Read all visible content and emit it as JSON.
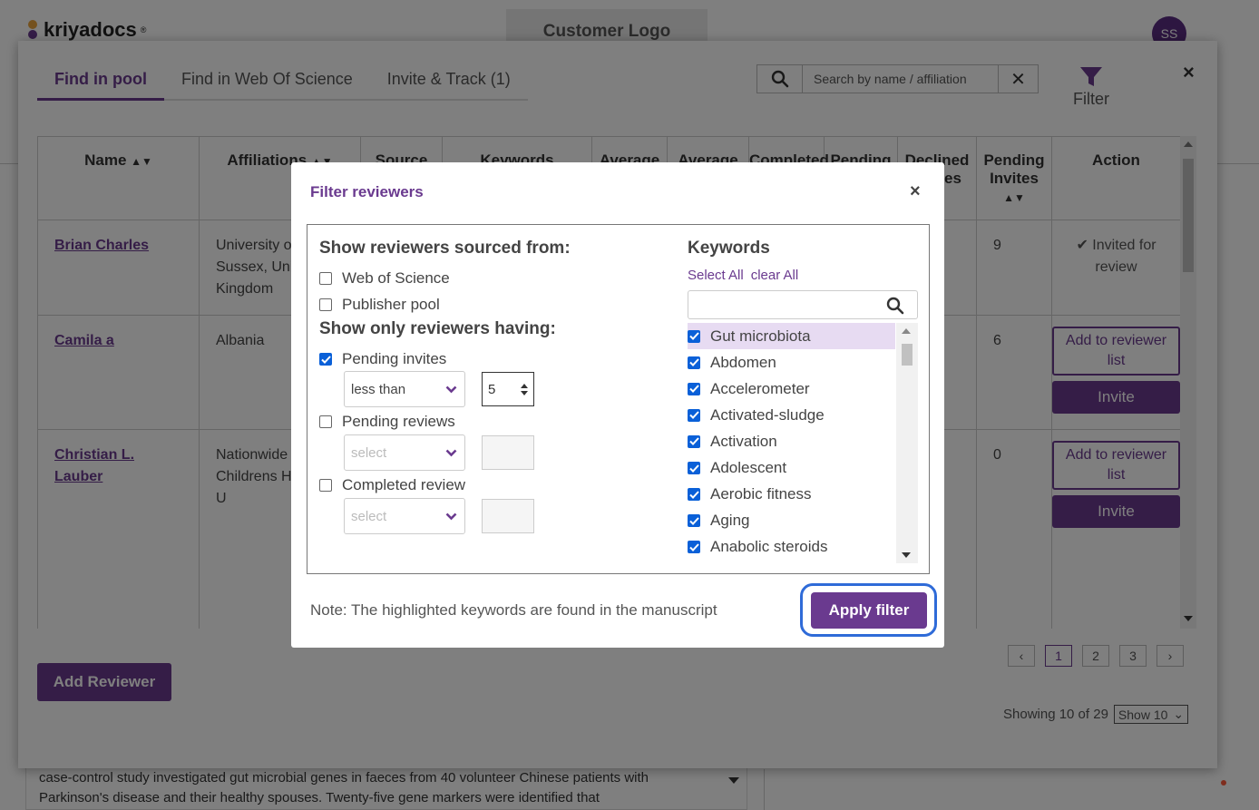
{
  "app": {
    "logo_text": "kriyadocs",
    "logo_mark": "®",
    "customer_logo": "Customer Logo",
    "avatar_initials": "SS",
    "abstract_text": "case-control study investigated gut microbial genes in faeces from 40 volunteer Chinese patients with Parkinson's disease and their healthy spouses. Twenty-five gene markers were identified that"
  },
  "reviewer_modal": {
    "tabs": [
      {
        "label": "Find in pool",
        "active": true
      },
      {
        "label": "Find in Web Of Science",
        "active": false
      },
      {
        "label": "Invite & Track (1)",
        "active": false
      }
    ],
    "search_placeholder": "Search by name / affiliation",
    "search_clear": "✕",
    "filter_label": "Filter",
    "close": "×",
    "table": {
      "headers": [
        "Name",
        "Affiliations",
        "Source",
        "Keywords",
        "Average",
        "Average",
        "Completed",
        "Pending",
        "Declined Invites",
        "Pending Invites",
        "Action"
      ],
      "rows": [
        {
          "name": "Brian Charles",
          "affiliation": "University of Sussex, United Kingdom",
          "pending_invites": "9",
          "action": "Invited for review"
        },
        {
          "name": "Camila a",
          "affiliation": "Albania",
          "pending_invites": "6",
          "action_add": "Add to reviewer list",
          "action_invite": "Invite"
        },
        {
          "name": "Christian L. Lauber",
          "affiliation": "Nationwide Childrens Hospital, U",
          "pending_invites": "0",
          "action_add": "Add to reviewer list",
          "action_invite": "Invite"
        }
      ]
    },
    "add_reviewer": "Add Reviewer",
    "pagination": {
      "pages": [
        "1",
        "2",
        "3"
      ],
      "current": "1"
    },
    "showing": "Showing 10 of 29",
    "page_size": "Show 10"
  },
  "filter_dialog": {
    "title": "Filter reviewers",
    "close": "×",
    "sourced_from_title": "Show reviewers sourced from:",
    "sources": [
      {
        "label": "Web of Science",
        "checked": false
      },
      {
        "label": "Publisher pool",
        "checked": false
      }
    ],
    "having_title": "Show only reviewers having:",
    "criteria": [
      {
        "label": "Pending invites",
        "checked": true,
        "operator": "less than",
        "value": "5"
      },
      {
        "label": "Pending reviews",
        "checked": false,
        "operator": "select",
        "value": ""
      },
      {
        "label": "Completed review",
        "checked": false,
        "operator": "select",
        "value": ""
      }
    ],
    "keywords_title": "Keywords",
    "select_all": "Select All",
    "clear_all": "clear All",
    "keyword_search_placeholder": "",
    "keywords": [
      {
        "label": "Gut microbiota",
        "checked": true,
        "highlight": true
      },
      {
        "label": "Abdomen",
        "checked": true,
        "highlight": false
      },
      {
        "label": "Accelerometer",
        "checked": true,
        "highlight": false
      },
      {
        "label": "Activated-sludge",
        "checked": true,
        "highlight": false
      },
      {
        "label": "Activation",
        "checked": true,
        "highlight": false
      },
      {
        "label": "Adolescent",
        "checked": true,
        "highlight": false
      },
      {
        "label": "Aerobic fitness",
        "checked": true,
        "highlight": false
      },
      {
        "label": "Aging",
        "checked": true,
        "highlight": false
      },
      {
        "label": "Anabolic steroids",
        "checked": true,
        "highlight": false
      }
    ],
    "note": "Note: The highlighted keywords are found in the manuscript",
    "apply_label": "Apply filter"
  },
  "colors": {
    "brand": "#6a3a8f",
    "highlight": "#e7dbf2",
    "checkbox": "#0a60d8",
    "focus_ring": "#2f6bd8"
  }
}
